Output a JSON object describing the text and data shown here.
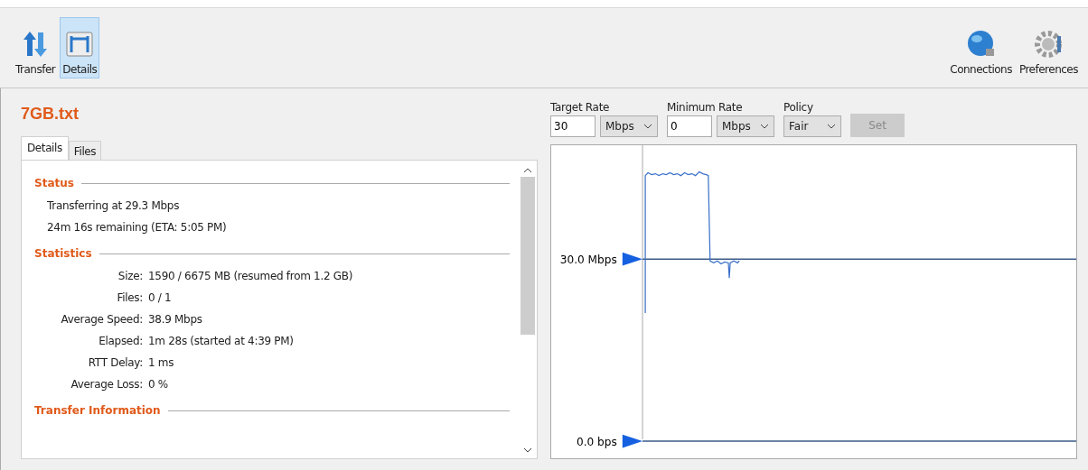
{
  "toolbar": {
    "left": [
      {
        "kind": "transfer",
        "label": "Transfer",
        "selected": false
      },
      {
        "kind": "details",
        "label": "Details",
        "selected": true
      }
    ],
    "right": [
      {
        "kind": "connections",
        "label": "Connections",
        "selected": false
      },
      {
        "kind": "preferences",
        "label": "Preferences",
        "selected": false
      }
    ]
  },
  "file_title": "7GB.txt",
  "tabs": [
    {
      "label": "Details",
      "selected": true
    },
    {
      "label": "Files",
      "selected": false
    }
  ],
  "sections": [
    {
      "title": "Status",
      "kind": "lines",
      "lines": [
        "Transferring at 29.3 Mbps",
        "24m 16s remaining (ETA: 5:05 PM)"
      ]
    },
    {
      "title": "Statistics",
      "kind": "pairs",
      "pairs": [
        {
          "label": "Size:",
          "value": "1590 / 6675 MB (resumed from 1.2 GB)"
        },
        {
          "label": "Files:",
          "value": "0 / 1"
        },
        {
          "label": "Average Speed:",
          "value": "38.9 Mbps"
        },
        {
          "label": "Elapsed:",
          "value": "1m 28s (started at 4:39 PM)"
        },
        {
          "label": "RTT Delay:",
          "value": "1 ms"
        },
        {
          "label": "Average Loss:",
          "value": "0 %"
        }
      ]
    },
    {
      "title": "Transfer Information",
      "kind": "lines"
    }
  ],
  "controls": {
    "target_rate": {
      "label": "Target Rate",
      "value": "30",
      "unit": "Mbps"
    },
    "minimum_rate": {
      "label": "Minimum Rate",
      "value": "0",
      "unit": "Mbps"
    },
    "policy": {
      "label": "Policy",
      "value": "Fair"
    },
    "set_button": {
      "label": "Set",
      "disabled": true
    }
  },
  "graph": {
    "target_label": "30.0 Mbps",
    "minimum_label": "0.0 bps"
  }
}
